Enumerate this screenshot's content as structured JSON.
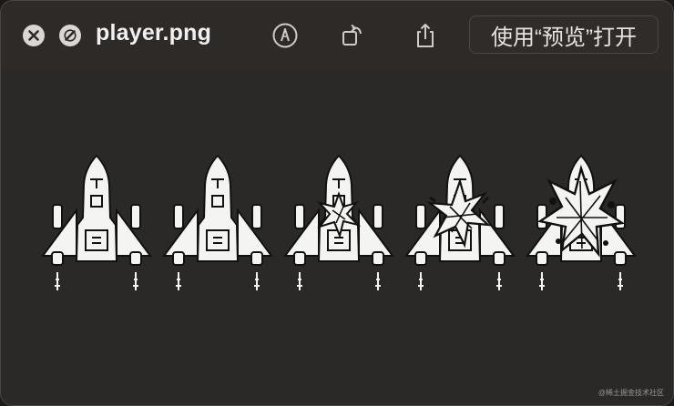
{
  "window": {
    "title": "player.png",
    "open_with_label": "使用“预览”打开"
  },
  "toolbar": {
    "close_icon": "close-icon",
    "fullscreen_icon": "fullscreen-icon",
    "markup_icon": "markup-pen-icon",
    "rotate_icon": "rotate-icon",
    "share_icon": "share-icon"
  },
  "image": {
    "description_frames": 5
  },
  "watermark": "@稀土掘金技术社区",
  "colors": {
    "window_bg": "#2d2a28",
    "text": "#f2f0ee",
    "sprite": "#f4f4f2"
  }
}
